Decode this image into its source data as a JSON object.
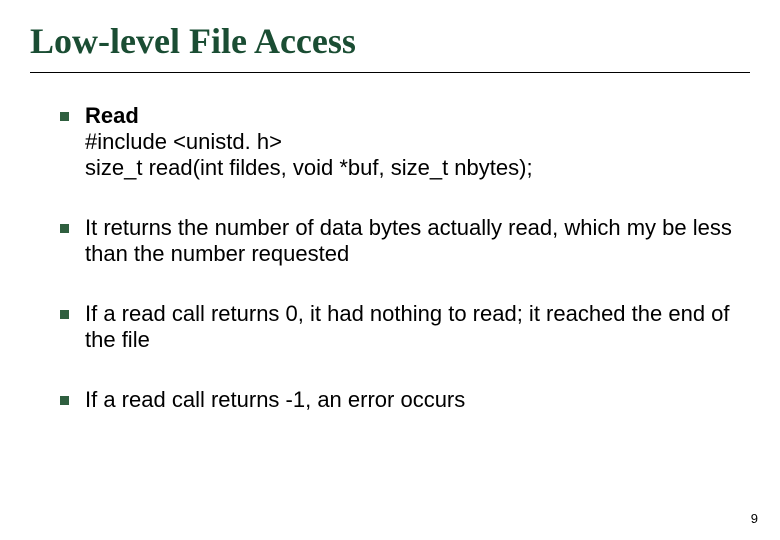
{
  "title": "Low-level File Access",
  "items": [
    {
      "heading": "Read",
      "lines": [
        "#include <unistd. h>",
        "size_t read(int fildes, void *buf, size_t nbytes);"
      ]
    },
    {
      "text": "It returns the number of data bytes actually read, which my be less than the number requested"
    },
    {
      "text": "If a read call returns 0, it had nothing to read; it reached the end of the file"
    },
    {
      "text": "If a read call returns -1, an error occurs"
    }
  ],
  "page_number": "9"
}
